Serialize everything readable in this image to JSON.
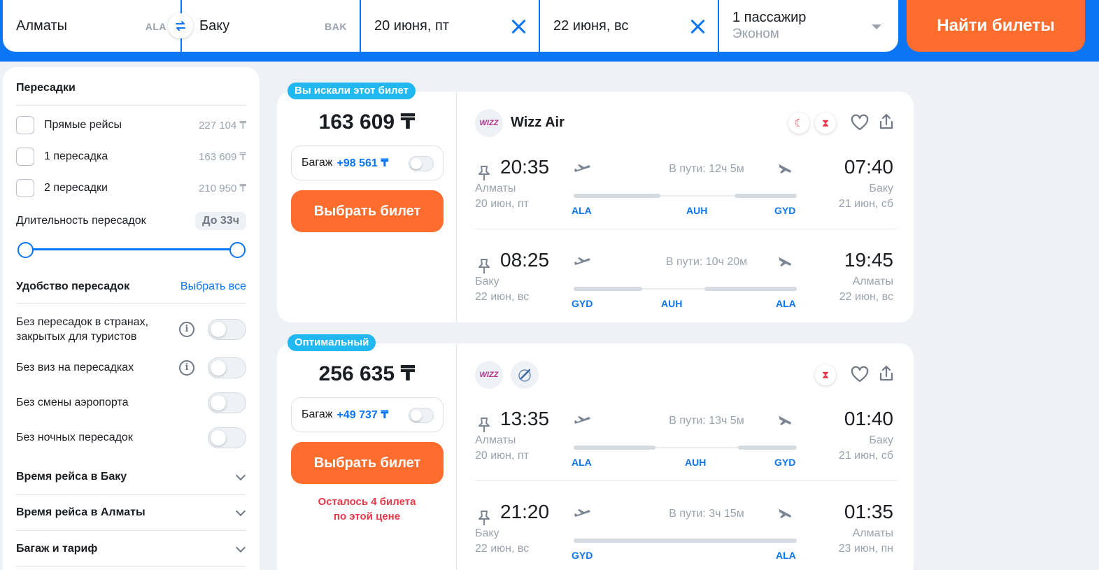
{
  "search": {
    "from_city": "Алматы",
    "from_code": "ALA",
    "to_city": "Баку",
    "to_code": "BAK",
    "date_out": "20 июня, пт",
    "date_back": "22 июня, вс",
    "passengers": "1 пассажир",
    "cabin_class": "Эконом",
    "find_button": "Найти билеты",
    "swap_icon": "swap-arrows-icon"
  },
  "filters": {
    "stops_title": "Пересадки",
    "stops": [
      {
        "label": "Прямые рейсы",
        "price": "227 104 ₸"
      },
      {
        "label": "1 пересадка",
        "price": "163 609 ₸"
      },
      {
        "label": "2 пересадки",
        "price": "210 950 ₸"
      }
    ],
    "duration_label": "Длительность пересадок",
    "duration_value": "До 33ч",
    "comfort_title": "Удобство пересадок",
    "select_all": "Выбрать все",
    "comfort": [
      {
        "label": "Без пересадок в странах, закрытых для туристов"
      },
      {
        "label": "Без виз на пересадках"
      },
      {
        "label": "Без смены аэропорта"
      },
      {
        "label": "Без ночных пересадок"
      }
    ],
    "sections": [
      "Время рейса в Баку",
      "Время рейса в Алматы",
      "Багаж и тариф"
    ]
  },
  "tickets": [
    {
      "tag": "Вы искали этот билет",
      "price": "163 609 ₸",
      "baggage_label": "Багаж",
      "baggage_price": "+98 561 ₸",
      "choose": "Выбрать билет",
      "note_line1": "",
      "note_line2": "",
      "airline": "Wizz Air",
      "logo_text": "WIZZ",
      "segments": [
        {
          "dep_time": "20:35",
          "dep_city": "Алматы",
          "dep_date": "20 июн, пт",
          "duration": "В пути: 12ч 5м",
          "arr_time": "07:40",
          "arr_city": "Баку",
          "arr_date": "21 июн, сб",
          "codes": [
            "ALA",
            "AUH",
            "GYD"
          ]
        },
        {
          "dep_time": "08:25",
          "dep_city": "Баку",
          "dep_date": "22 июн, вс",
          "duration": "В пути: 10ч 20м",
          "arr_time": "19:45",
          "arr_city": "Алматы",
          "arr_date": "22 июн, вс",
          "codes": [
            "GYD",
            "AUH",
            "ALA"
          ]
        }
      ]
    },
    {
      "tag": "Оптимальный",
      "price": "256 635 ₸",
      "baggage_label": "Багаж",
      "baggage_price": "+49 737 ₸",
      "choose": "Выбрать билет",
      "note_line1": "Осталось 4 билета",
      "note_line2": "по этой цене",
      "airline": "",
      "logo_text": "WIZZ",
      "segments": [
        {
          "dep_time": "13:35",
          "dep_city": "Алматы",
          "dep_date": "20 июн, пт",
          "duration": "В пути: 13ч 5м",
          "arr_time": "01:40",
          "arr_city": "Баку",
          "arr_date": "21 июн, сб",
          "codes": [
            "ALA",
            "AUH",
            "GYD"
          ]
        },
        {
          "dep_time": "21:20",
          "dep_city": "Баку",
          "dep_date": "22 июн, вс",
          "duration": "В пути: 3ч 15м",
          "arr_time": "01:35",
          "arr_city": "Алматы",
          "arr_date": "23 июн, пн",
          "codes": [
            "GYD",
            "ALA"
          ]
        }
      ]
    }
  ],
  "colors": {
    "brand_blue": "#0a75f5",
    "accent_orange": "#ff6d2e",
    "tag_cyan": "#21b7f0",
    "warning_red": "#ea3a4a"
  }
}
